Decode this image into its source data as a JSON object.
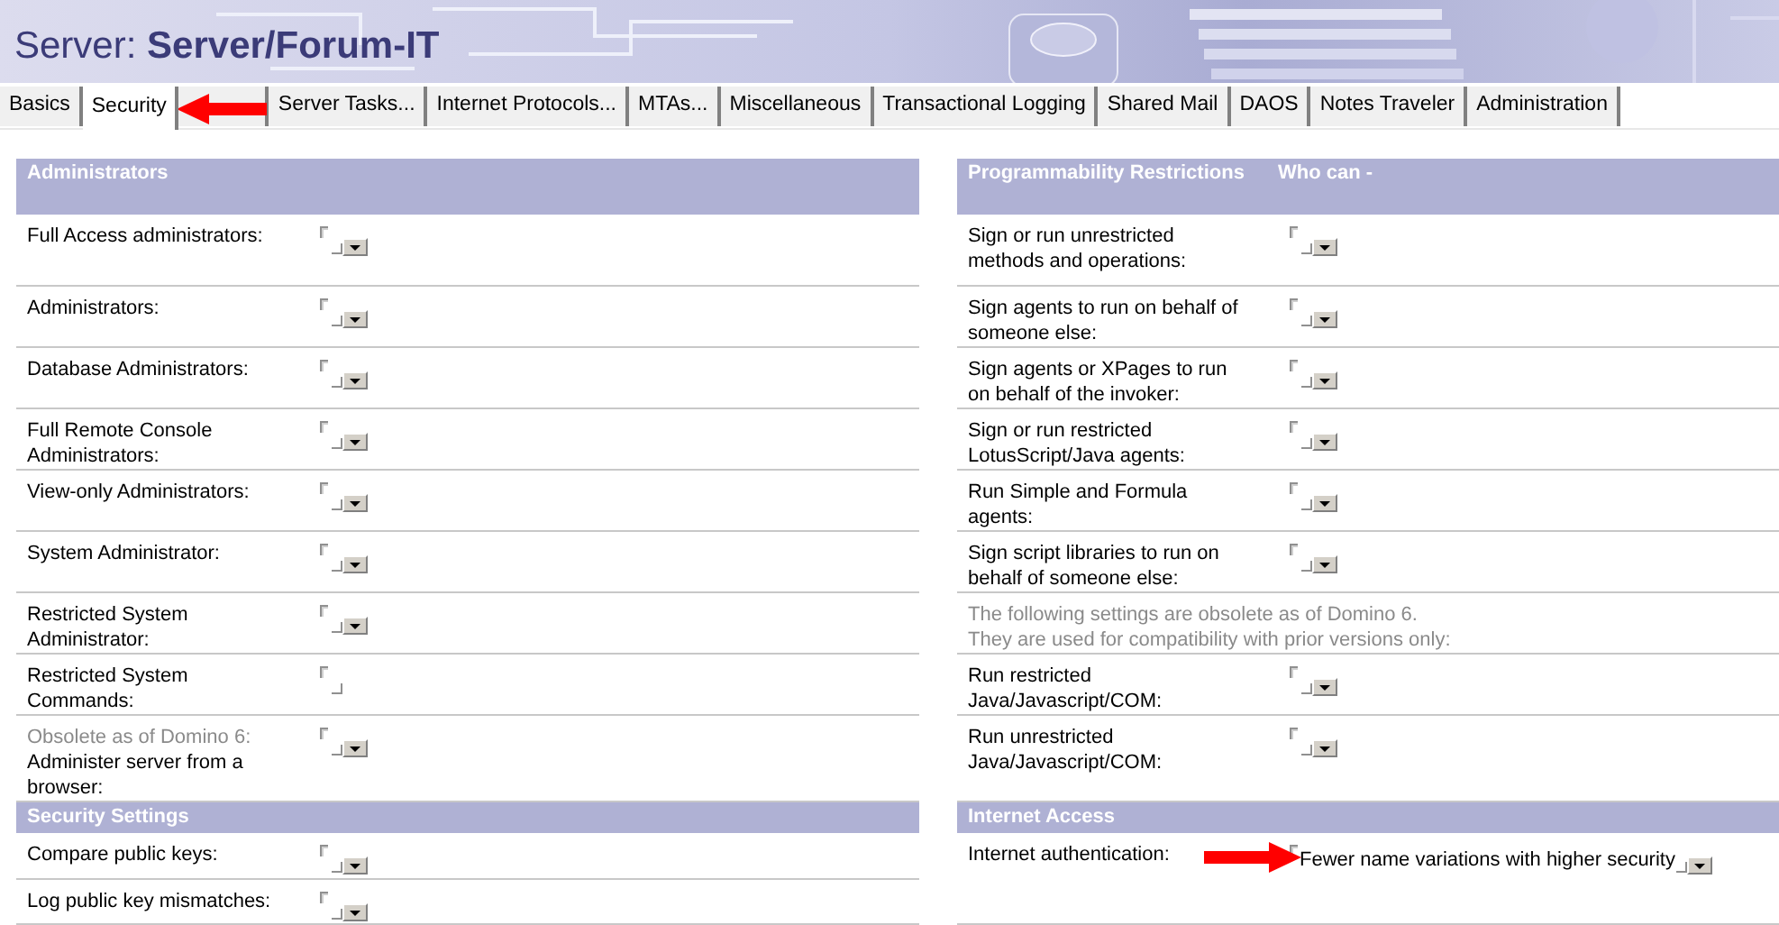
{
  "banner": {
    "title": "Server: **Server/Forum-IT**"
  },
  "tabs": [
    {
      "label": "Basics",
      "selected": false
    },
    {
      "label": "Security",
      "selected": true
    },
    {
      "label": "Server Tasks...",
      "selected": false
    },
    {
      "label": "Internet Protocols...",
      "selected": false
    },
    {
      "label": "MTAs...",
      "selected": false
    },
    {
      "label": "Miscellaneous",
      "selected": false
    },
    {
      "label": "Transactional Logging",
      "selected": false
    },
    {
      "label": "Shared Mail",
      "selected": false
    },
    {
      "label": "DAOS",
      "selected": false
    },
    {
      "label": "Notes Traveler",
      "selected": false
    },
    {
      "label": "Administration",
      "selected": false
    }
  ],
  "left": {
    "sections": [
      {
        "title": "Administrators",
        "fields": [
          {
            "kind": "field",
            "label": "Full Access administrators:",
            "dropdown": true
          },
          {
            "kind": "field",
            "label": "Administrators:",
            "dropdown": true
          },
          {
            "kind": "field",
            "label": "Database Administrators:",
            "dropdown": true
          },
          {
            "kind": "field",
            "label": "Full Remote Console Administrators:",
            "dropdown": true
          },
          {
            "kind": "field",
            "label": "View-only Administrators:",
            "dropdown": true
          },
          {
            "kind": "field",
            "label": "System Administrator:",
            "dropdown": true
          },
          {
            "kind": "field",
            "label": "Restricted System Administrator:",
            "dropdown": true
          },
          {
            "kind": "field",
            "label": "Restricted System Commands:",
            "dropdown": false
          },
          {
            "kind": "field",
            "note": "Obsolete as of Domino 6:",
            "label": "Administer server from a browser:",
            "dropdown": true
          }
        ]
      },
      {
        "title": "Security Settings",
        "fields": [
          {
            "kind": "field",
            "label": "Compare public keys:",
            "dropdown": true
          },
          {
            "kind": "field",
            "label": "Log public key mismatches:",
            "dropdown": true
          }
        ]
      }
    ]
  },
  "right": {
    "sections": [
      {
        "title": "Programmability Restrictions",
        "subtitle": "Who can -",
        "fields": [
          {
            "kind": "field",
            "label": "Sign or run unrestricted methods and operations:",
            "dropdown": true
          },
          {
            "kind": "field",
            "label": "Sign agents to run on behalf of someone else:",
            "dropdown": true
          },
          {
            "kind": "field",
            "label": "Sign agents or XPages to run on behalf of the invoker:",
            "dropdown": true
          },
          {
            "kind": "field",
            "label": "Sign or run restricted LotusScript/Java agents:",
            "dropdown": true
          },
          {
            "kind": "field",
            "label": "Run Simple and Formula agents:",
            "dropdown": true
          },
          {
            "kind": "field",
            "label": "Sign script libraries to run on behalf of someone else:",
            "dropdown": true
          },
          {
            "kind": "note",
            "lines": [
              "The following settings are obsolete as of Domino 6.",
              "They are used for compatibility with prior versions only:"
            ]
          },
          {
            "kind": "field",
            "label": "Run restricted Java/Javascript/COM:",
            "dropdown": true
          },
          {
            "kind": "field",
            "label": "Run unrestricted Java/Javascript/COM:",
            "dropdown": true
          }
        ]
      },
      {
        "title": "Internet Access",
        "fields": [
          {
            "kind": "field",
            "label": "Internet authentication:",
            "value": "Fewer name variations with higher security",
            "dropdown": true,
            "pointer": true
          }
        ]
      }
    ]
  }
}
